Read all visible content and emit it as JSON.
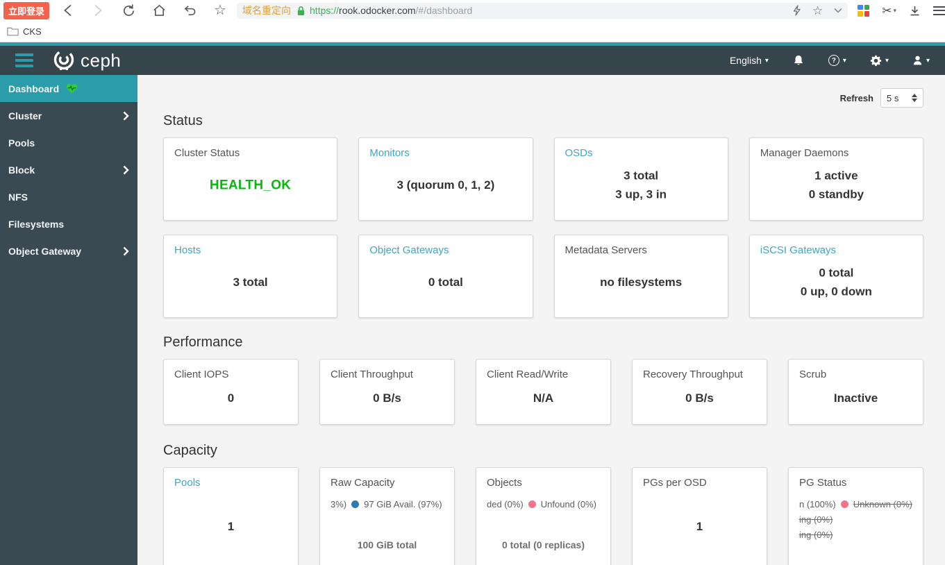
{
  "browser": {
    "login_button": "立即登录",
    "bookmark_folder": "CKS",
    "address": {
      "site_label": "域名重定向",
      "protocol": "https://",
      "domain": "rook.odocker.com",
      "path": "/#/dashboard"
    }
  },
  "app_header": {
    "brand": "ceph",
    "language_menu": "English",
    "help_glyph": "?"
  },
  "sidebar": {
    "items": [
      {
        "label": "Dashboard"
      },
      {
        "label": "Cluster"
      },
      {
        "label": "Pools"
      },
      {
        "label": "Block"
      },
      {
        "label": "NFS"
      },
      {
        "label": "Filesystems"
      },
      {
        "label": "Object Gateway"
      }
    ]
  },
  "refresh": {
    "label": "Refresh",
    "value": "5 s"
  },
  "status": {
    "heading": "Status",
    "cards": [
      {
        "title": "Cluster Status",
        "lines": [
          "HEALTH_OK"
        ]
      },
      {
        "title": "Monitors",
        "lines": [
          "3 (quorum 0, 1, 2)"
        ]
      },
      {
        "title": "OSDs",
        "lines": [
          "3 total",
          "3 up, 3 in"
        ]
      },
      {
        "title": "Manager Daemons",
        "lines": [
          "1 active",
          "0 standby"
        ]
      },
      {
        "title": "Hosts",
        "lines": [
          "3 total"
        ]
      },
      {
        "title": "Object Gateways",
        "lines": [
          "0 total"
        ]
      },
      {
        "title": "Metadata Servers",
        "lines": [
          "no filesystems"
        ]
      },
      {
        "title": "iSCSI Gateways",
        "lines": [
          "0 total",
          "0 up, 0 down"
        ]
      }
    ]
  },
  "performance": {
    "heading": "Performance",
    "cards": [
      {
        "title": "Client IOPS",
        "value": "0"
      },
      {
        "title": "Client Throughput",
        "value": "0 B/s"
      },
      {
        "title": "Client Read/Write",
        "value": "N/A"
      },
      {
        "title": "Recovery Throughput",
        "value": "0 B/s"
      },
      {
        "title": "Scrub",
        "value": "Inactive"
      }
    ]
  },
  "capacity": {
    "heading": "Capacity",
    "pools": {
      "title": "Pools",
      "value": "1"
    },
    "raw_capacity": {
      "title": "Raw Capacity",
      "legend_left_fragment": "3%)",
      "legend_label": "97 GiB Avail. (97%)",
      "legend_dot_color": "#2b7bb2",
      "total": "100 GiB total"
    },
    "objects": {
      "title": "Objects",
      "legend_left_fragment": "ded (0%)",
      "legend_label": "Unfound (0%)",
      "legend_dot_color": "#f8718d",
      "total": "0 total (0 replicas)"
    },
    "pgs_per_osd": {
      "title": "PGs per OSD",
      "value": "1"
    },
    "pg_status": {
      "title": "PG Status",
      "legend_left_fragment": "n (100%)",
      "legend_label": "Unknown (0%)",
      "legend_dot_color": "#f8718d",
      "legend_line2": "ing (0%)",
      "legend_line3": "ing (0%)"
    }
  },
  "colors": {
    "accent_teal": "#2b9daa",
    "header_dark": "#36444c",
    "health_ok_green": "#04bb0c",
    "card_link": "#41a6c4"
  }
}
